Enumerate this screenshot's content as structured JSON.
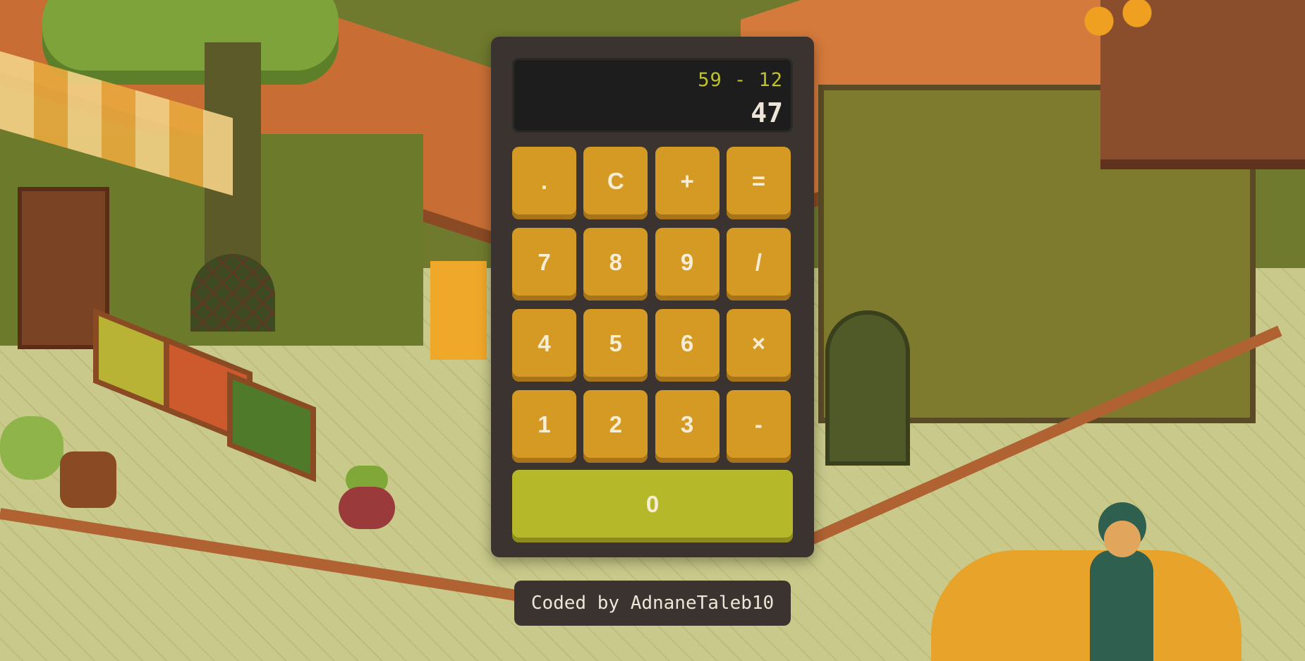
{
  "calculator": {
    "display": {
      "expression": "59 - 12",
      "result": "47"
    },
    "keys": [
      {
        "label": ".",
        "name": "decimal-key"
      },
      {
        "label": "C",
        "name": "clear-key"
      },
      {
        "label": "+",
        "name": "add-key"
      },
      {
        "label": "=",
        "name": "equals-key"
      },
      {
        "label": "7",
        "name": "digit-7-key"
      },
      {
        "label": "8",
        "name": "digit-8-key"
      },
      {
        "label": "9",
        "name": "digit-9-key"
      },
      {
        "label": "/",
        "name": "divide-key"
      },
      {
        "label": "4",
        "name": "digit-4-key"
      },
      {
        "label": "5",
        "name": "digit-5-key"
      },
      {
        "label": "6",
        "name": "digit-6-key"
      },
      {
        "label": "×",
        "name": "multiply-key"
      },
      {
        "label": "1",
        "name": "digit-1-key"
      },
      {
        "label": "2",
        "name": "digit-2-key"
      },
      {
        "label": "3",
        "name": "digit-3-key"
      },
      {
        "label": "-",
        "name": "subtract-key"
      }
    ],
    "zero_key": "0"
  },
  "footer": {
    "credit": "Coded by AdnaneTaleb10"
  },
  "colors": {
    "key": "#d59a23",
    "zero_key": "#b5b829",
    "expression_text": "#bec131",
    "result_text": "#ece6d8",
    "panel": "#3a3330",
    "display": "#1c1d1c"
  }
}
